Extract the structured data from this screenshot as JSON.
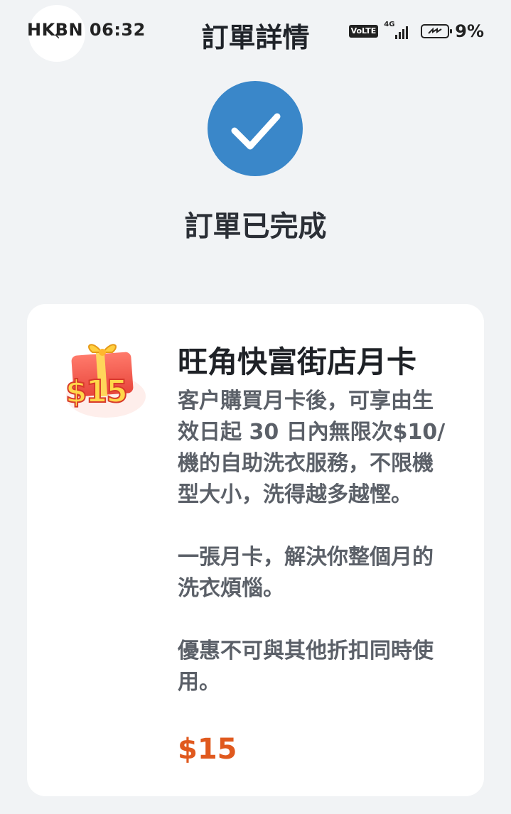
{
  "status_bar": {
    "carrier": "HKBN",
    "time": "06:32",
    "volte": "VoLTE",
    "network": "4G",
    "battery_pct": "9%"
  },
  "header": {
    "title": "訂單詳情"
  },
  "status": {
    "text": "訂單已完成"
  },
  "product": {
    "badge": "$15",
    "title": "旺角快富街店月卡",
    "description": [
      "客户購買月卡後，可享由生效日起 30 日內無限次$10/機的自助洗衣服務，不限機型大小，洗得越多越慳。",
      "一張月卡，解決你整個月的洗衣煩惱。",
      "優惠不可與其他折扣同時使用。"
    ],
    "price": "$15"
  },
  "colors": {
    "accent": "#3a87c9",
    "price": "#e0591e",
    "background": "#f1f3f5"
  }
}
